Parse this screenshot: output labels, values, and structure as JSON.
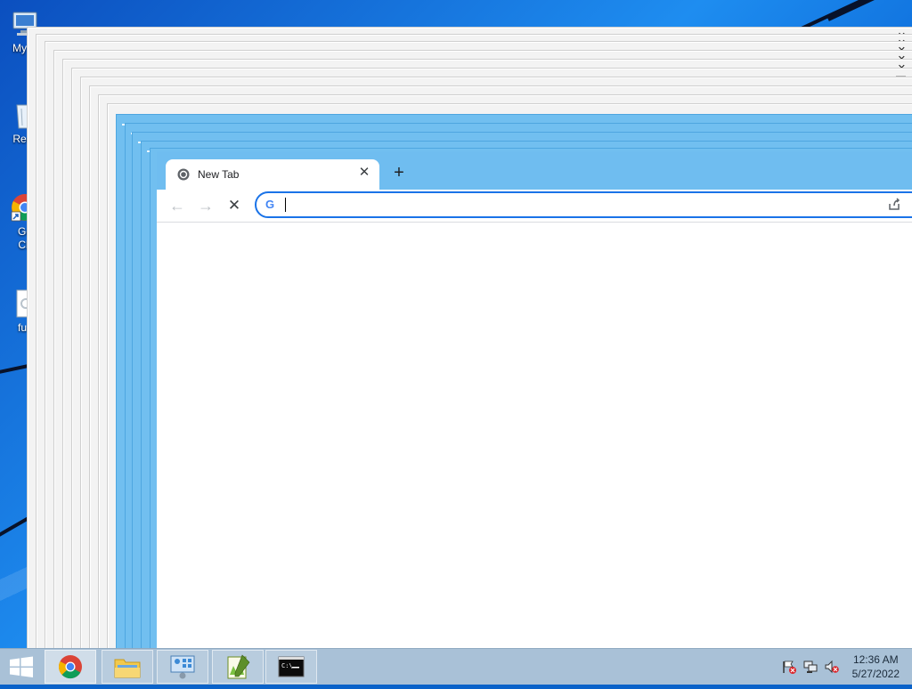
{
  "desktop": {
    "icons": [
      {
        "id": "my-computer",
        "label": "My C"
      },
      {
        "id": "recycle-bin",
        "label": "Recy"
      },
      {
        "id": "google-chrome",
        "label": "Go\nCh"
      },
      {
        "id": "file",
        "label": "fuc"
      }
    ]
  },
  "browser": {
    "tab": {
      "title": "New Tab"
    },
    "toolbar": {
      "back_icon": "arrow-left-icon",
      "forward_icon": "arrow-right-icon",
      "stop_icon": "close-icon",
      "share_icon": "share-icon"
    },
    "omnibox": {
      "value": "",
      "placeholder": "",
      "provider_icon": "G"
    }
  },
  "taskbar": {
    "items": [
      {
        "name": "chrome",
        "icon": "chrome-icon",
        "active": true
      },
      {
        "name": "file-explorer",
        "icon": "folder-icon",
        "active": false
      },
      {
        "name": "control-panel",
        "icon": "control-panel-icon",
        "active": false
      },
      {
        "name": "notepad-plus-plus",
        "icon": "notepad-plus-plus-icon",
        "active": false
      },
      {
        "name": "command-prompt",
        "icon": "terminal-icon",
        "active": false
      }
    ],
    "tray": {
      "flag_icon": "action-center-flag-icon",
      "network_icon": "network-icon",
      "volume_icon": "volume-muted-icon"
    },
    "clock": {
      "time": "12:36 AM",
      "date": "5/27/2022"
    }
  },
  "colors": {
    "accent": "#1a73e8",
    "chrome_frame": "#6fbdf0",
    "taskbar": "#a9c1d7"
  }
}
